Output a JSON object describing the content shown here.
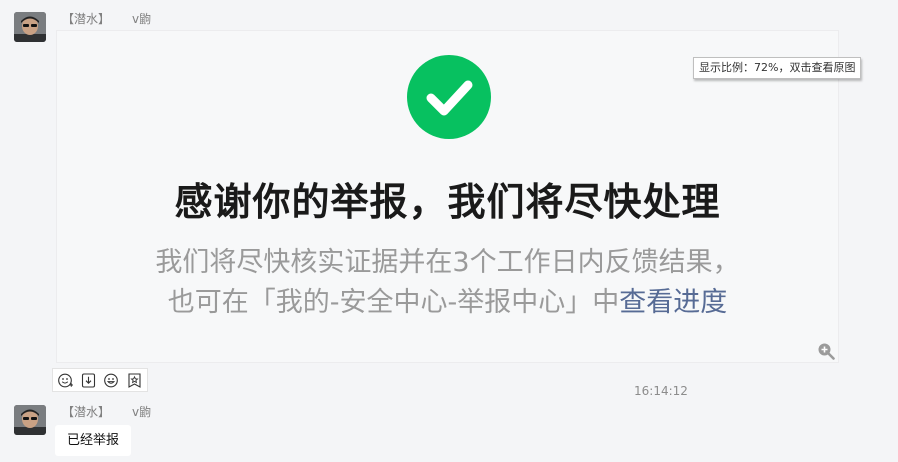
{
  "messages": [
    {
      "sender_tag": "【潜水】",
      "sender_name": "v鼩",
      "image": {
        "headline": "感谢你的举报，我们将尽快处理",
        "line1": "我们将尽快核实证据并在3个工作日内反馈结果，",
        "line2_prefix": "也可在「我的-安全中心-举报中心」中",
        "line2_link": "查看进度",
        "check_color": "#07c160",
        "tooltip": "显示比例：72%，双击查看原图",
        "zoom_icon": "zoom-in-icon"
      },
      "toolbar_icons": [
        "emoji-reply-icon",
        "download-icon",
        "emoji-add-icon",
        "favorite-icon"
      ]
    },
    {
      "time": "16:14:12",
      "sender_tag": "【潜水】",
      "sender_name": "v鼩",
      "text": "已经举报"
    }
  ],
  "colors": {
    "background": "#f4f5f7",
    "link": "#576b95",
    "accent": "#07c160"
  }
}
